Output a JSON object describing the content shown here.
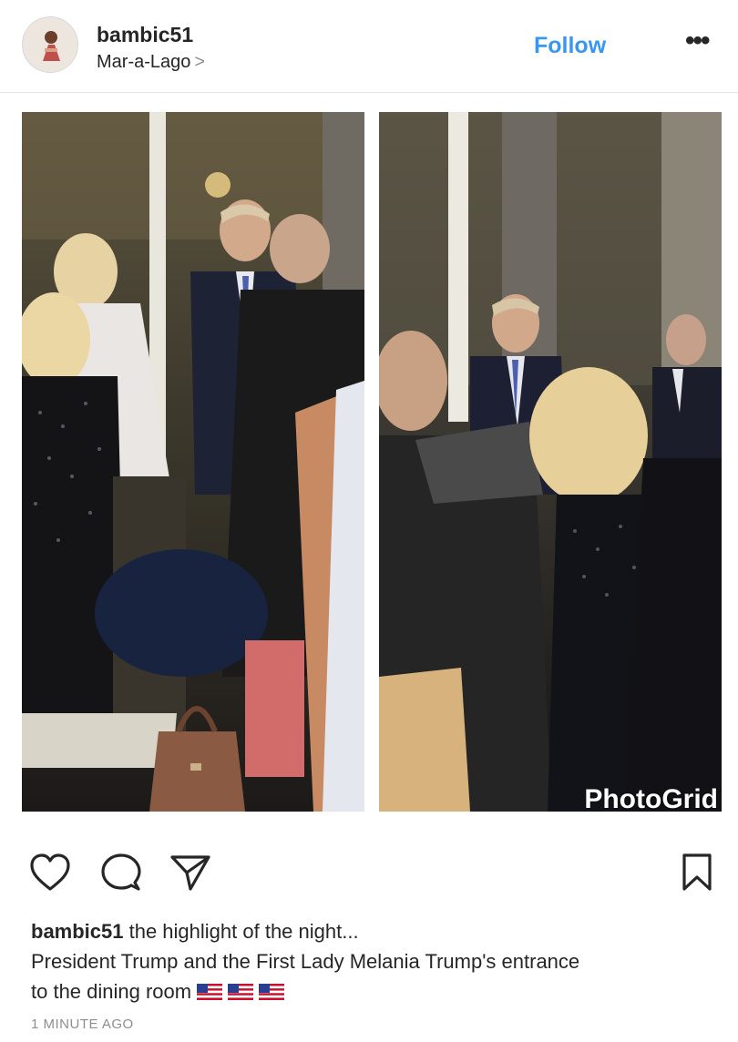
{
  "post": {
    "username": "bambic51",
    "location": "Mar-a-Lago",
    "location_chevron": ">",
    "follow_label": "Follow",
    "more_label": "•••"
  },
  "photo": {
    "watermark": "PhotoGrid"
  },
  "actions": {
    "like_icon": "heart-icon",
    "comment_icon": "comment-icon",
    "share_icon": "paper-plane-icon",
    "save_icon": "bookmark-icon"
  },
  "caption": {
    "username": "bambic51",
    "line1": " the highlight of the night...",
    "line2": "President Trump and the First Lady Melania Trump's entrance",
    "line3": "to the dining room",
    "flag_icon": "us-flag-icon",
    "flag_count": 3
  },
  "timestamp": "1 MINUTE AGO",
  "colors": {
    "accent": "#3897f0",
    "text": "#262626",
    "muted": "#8e8e8e"
  }
}
